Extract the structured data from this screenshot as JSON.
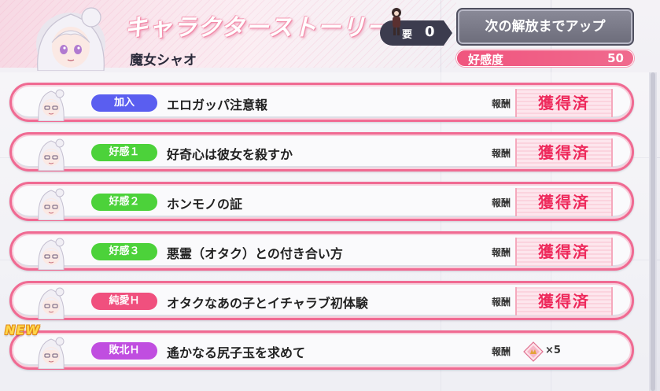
{
  "header": {
    "title": "キャラクターストーリー",
    "character_name": "魔女シャオ",
    "key": {
      "label": "要",
      "count": "0"
    },
    "unlock_button_label": "次の解放までアップ",
    "affinity": {
      "label": "好感度",
      "value": "50"
    }
  },
  "stories": [
    {
      "tag": "加入",
      "tag_color": "#5a5ef0",
      "title": "エロガッパ注意報",
      "reward_label": "報酬",
      "reward_status": "獲得済",
      "is_new": false
    },
    {
      "tag": "好感１",
      "tag_color": "#4cd23a",
      "title": "好奇心は彼女を殺すか",
      "reward_label": "報酬",
      "reward_status": "獲得済",
      "is_new": false
    },
    {
      "tag": "好感２",
      "tag_color": "#4cd23a",
      "title": "ホンモノの証",
      "reward_label": "報酬",
      "reward_status": "獲得済",
      "is_new": false
    },
    {
      "tag": "好感３",
      "tag_color": "#4cd23a",
      "title": "悪霊（オタク）との付き合い方",
      "reward_label": "報酬",
      "reward_status": "獲得済",
      "is_new": false
    },
    {
      "tag": "純愛Ｈ",
      "tag_color": "#f0507e",
      "title": "オタクなあの子とイチャラブ初体験",
      "reward_label": "報酬",
      "reward_status": "獲得済",
      "is_new": false
    },
    {
      "tag": "敗北Ｈ",
      "tag_color": "#c04ee0",
      "title": "遙かなる尻子玉を求めて",
      "reward_label": "報酬",
      "reward_count": "×5",
      "reward_icon": "gem-icon",
      "is_new": true
    }
  ],
  "new_badge": "NEW",
  "colors": {
    "accent": "#f06a92",
    "obtained": "#ee2a5c",
    "affinity": "#f0557e"
  }
}
